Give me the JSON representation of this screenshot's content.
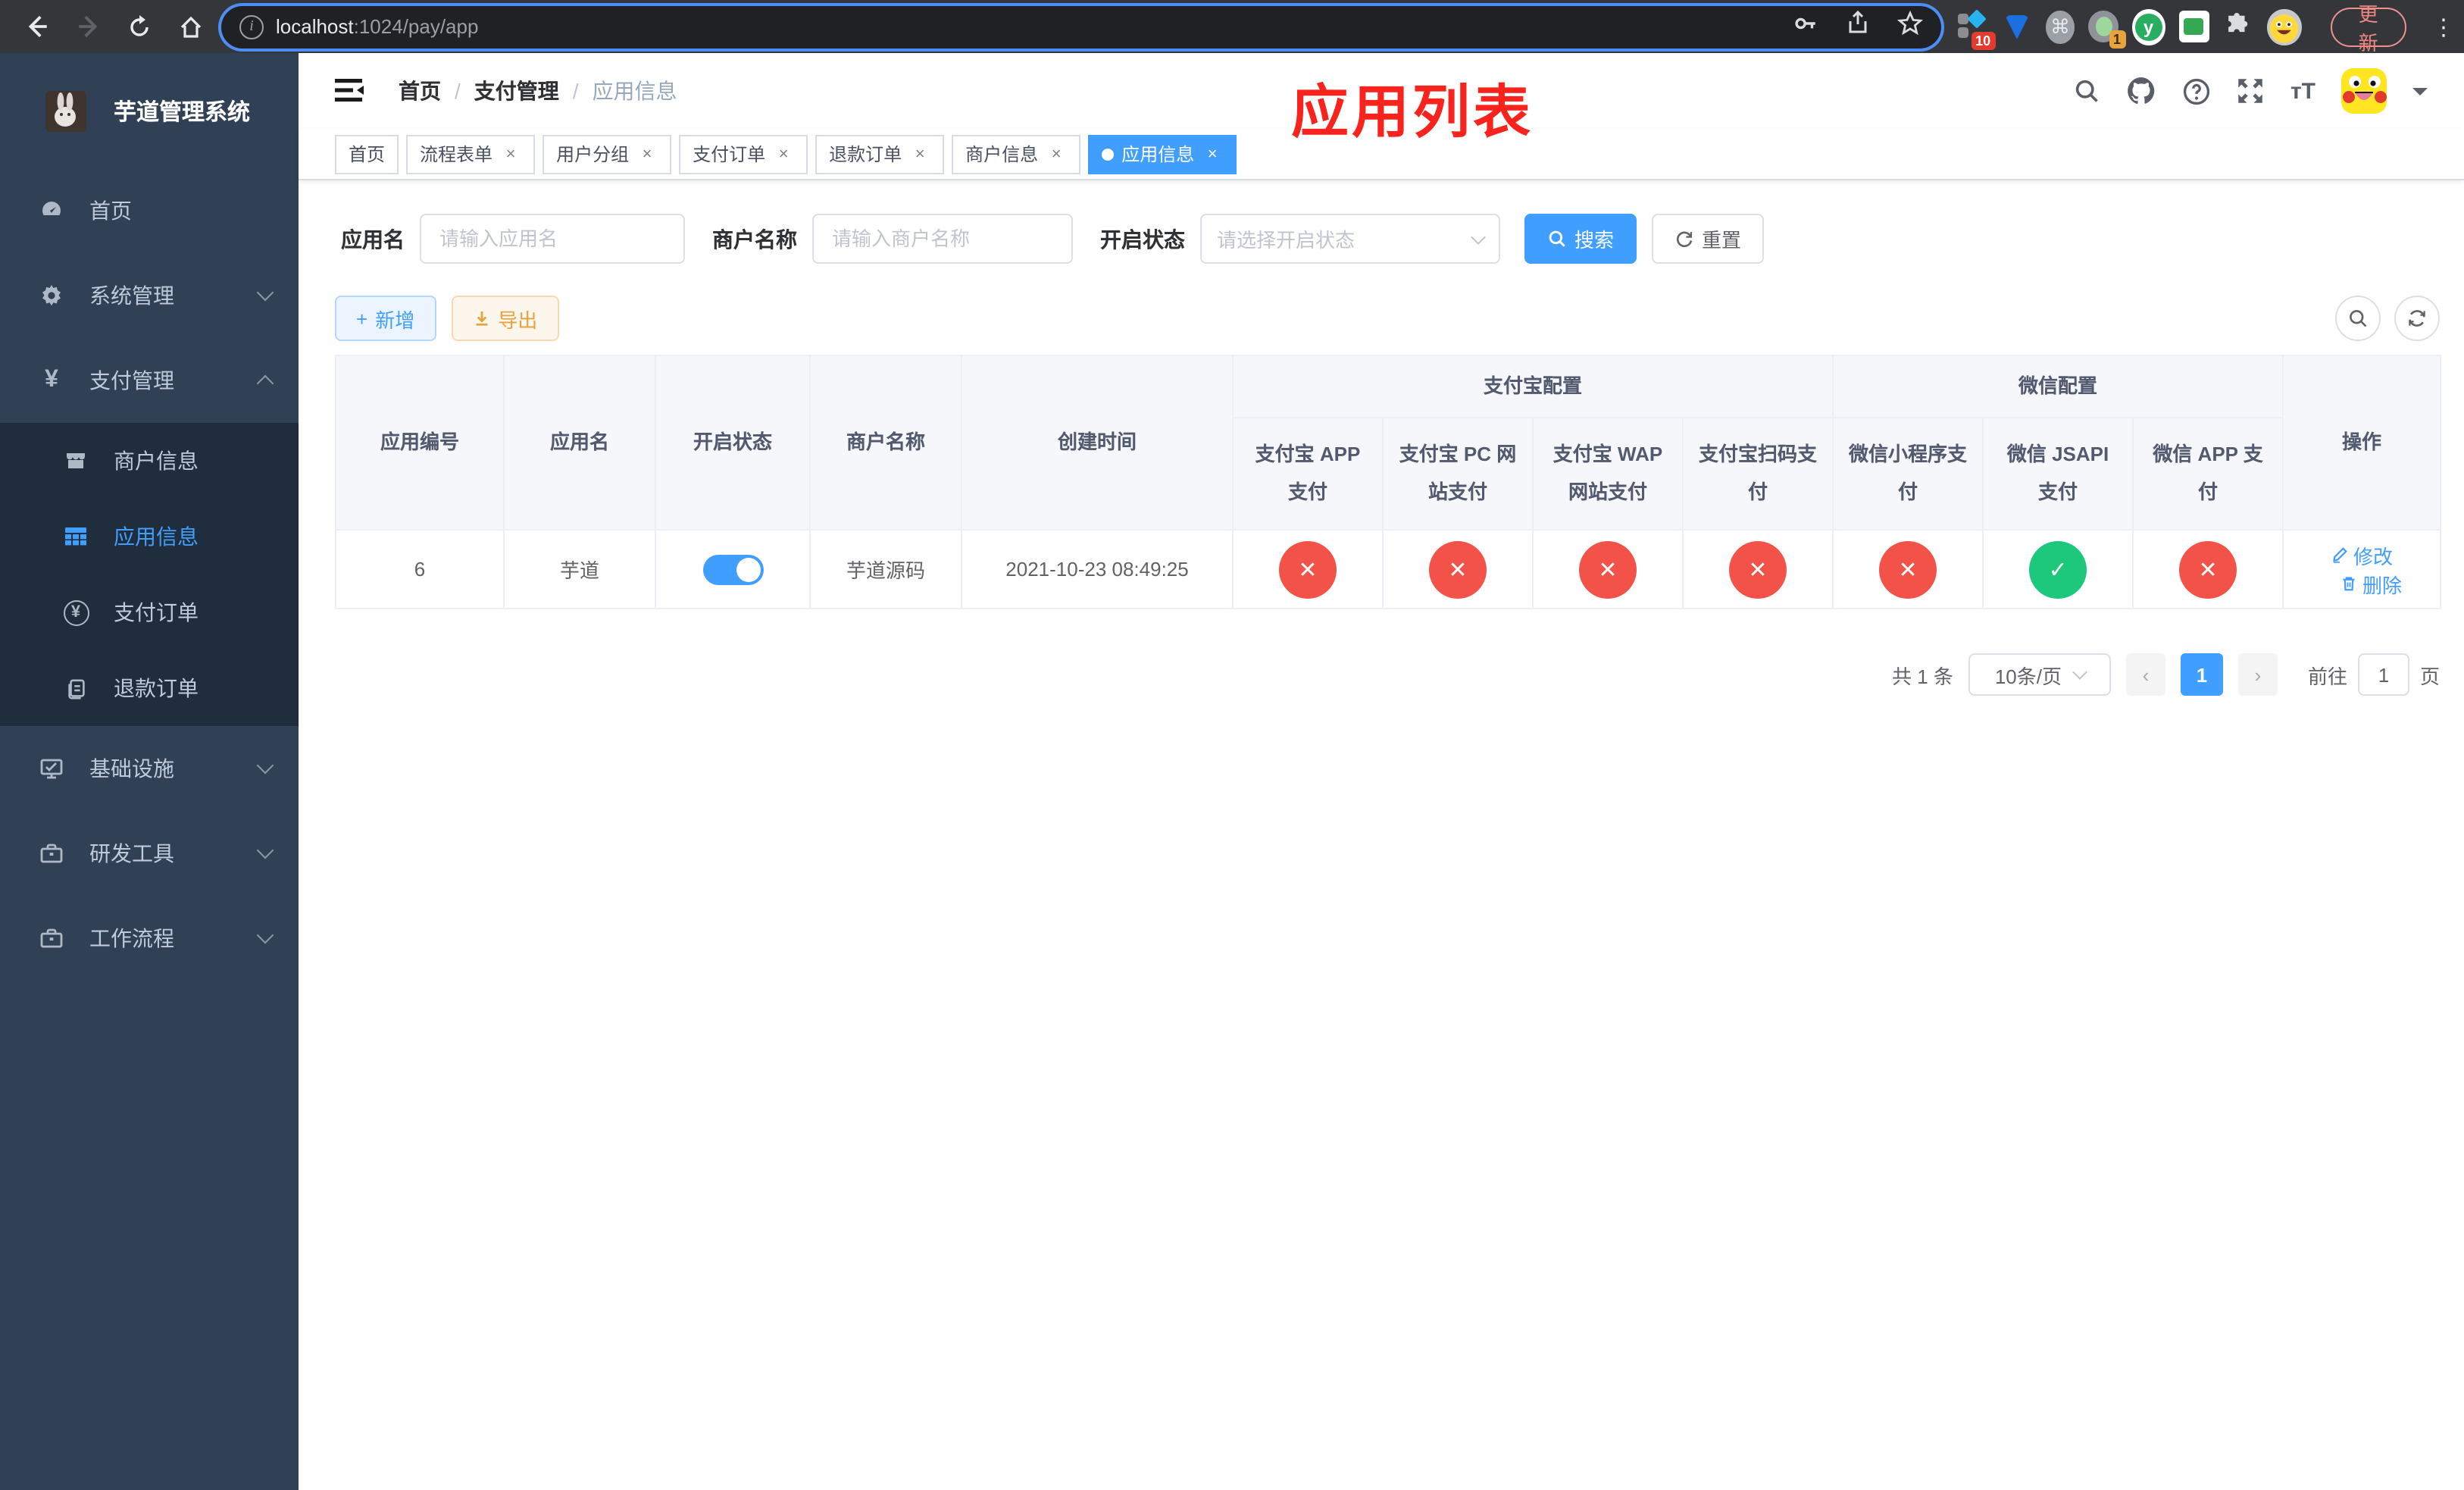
{
  "browser": {
    "url_host": "localhost",
    "url_rest": ":1024/pay/app",
    "update_button": "更新",
    "ext_badge_count": "10",
    "ext_profile_badge": "1",
    "ext_letter": "y"
  },
  "sidebar": {
    "logo_title": "芋道管理系统",
    "menu": [
      {
        "label": "首页"
      },
      {
        "label": "系统管理"
      },
      {
        "label": "支付管理"
      },
      {
        "label": "商户信息"
      },
      {
        "label": "应用信息"
      },
      {
        "label": "支付订单"
      },
      {
        "label": "退款订单"
      },
      {
        "label": "基础设施"
      },
      {
        "label": "研发工具"
      },
      {
        "label": "工作流程"
      }
    ]
  },
  "header": {
    "breadcrumb": [
      {
        "label": "首页"
      },
      {
        "label": "支付管理"
      },
      {
        "label": "应用信息"
      }
    ],
    "annotation_title": "应用列表"
  },
  "tabs": [
    {
      "label": "首页"
    },
    {
      "label": "流程表单",
      "close": "×"
    },
    {
      "label": "用户分组",
      "close": "×"
    },
    {
      "label": "支付订单",
      "close": "×"
    },
    {
      "label": "退款订单",
      "close": "×"
    },
    {
      "label": "商户信息",
      "close": "×"
    },
    {
      "label": "应用信息",
      "close": "×",
      "state": "active"
    }
  ],
  "filters": {
    "app_name_label": "应用名",
    "app_name_placeholder": "请输入应用名",
    "merchant_label": "商户名称",
    "merchant_placeholder": "请输入商户名称",
    "status_label": "开启状态",
    "status_placeholder": "请选择开启状态",
    "search_label": "搜索",
    "reset_label": "重置"
  },
  "toolbar": {
    "add_label": "新增",
    "export_label": "导出"
  },
  "table": {
    "group_alipay": "支付宝配置",
    "group_wechat": "微信配置",
    "columns": [
      "应用编号",
      "应用名",
      "开启状态",
      "商户名称",
      "创建时间",
      "支付宝 APP 支付",
      "支付宝 PC 网站支付",
      "支付宝 WAP 网站支付",
      "支付宝扫码支付",
      "微信小程序支付",
      "微信 JSAPI 支付",
      "微信 APP 支付",
      "操作"
    ],
    "rows": [
      {
        "id": "6",
        "name": "芋道",
        "enabled": "on",
        "merchant": "芋道源码",
        "created_at": "2021-10-23 08:49:25",
        "statuses": [
          {
            "state": "error",
            "glyph": "✕"
          },
          {
            "state": "error",
            "glyph": "✕"
          },
          {
            "state": "error",
            "glyph": "✕"
          },
          {
            "state": "error",
            "glyph": "✕"
          },
          {
            "state": "error",
            "glyph": "✕"
          },
          {
            "state": "success",
            "glyph": "✓"
          },
          {
            "state": "error",
            "glyph": "✕"
          }
        ],
        "edit_label": "修改",
        "delete_label": "删除"
      }
    ]
  },
  "pagination": {
    "total_text": "共 1 条",
    "page_size": "10条/页",
    "current_page": "1",
    "goto_label": "前往",
    "goto_value": "1",
    "unit_label": "页"
  },
  "colors": {
    "accent": "#409eff",
    "success": "#1dc77c",
    "danger": "#f35249",
    "warning": "#e6a23c",
    "annotation": "#f7231c",
    "sidebar_bg": "#304156",
    "submenu_bg": "#1f2d3d"
  }
}
